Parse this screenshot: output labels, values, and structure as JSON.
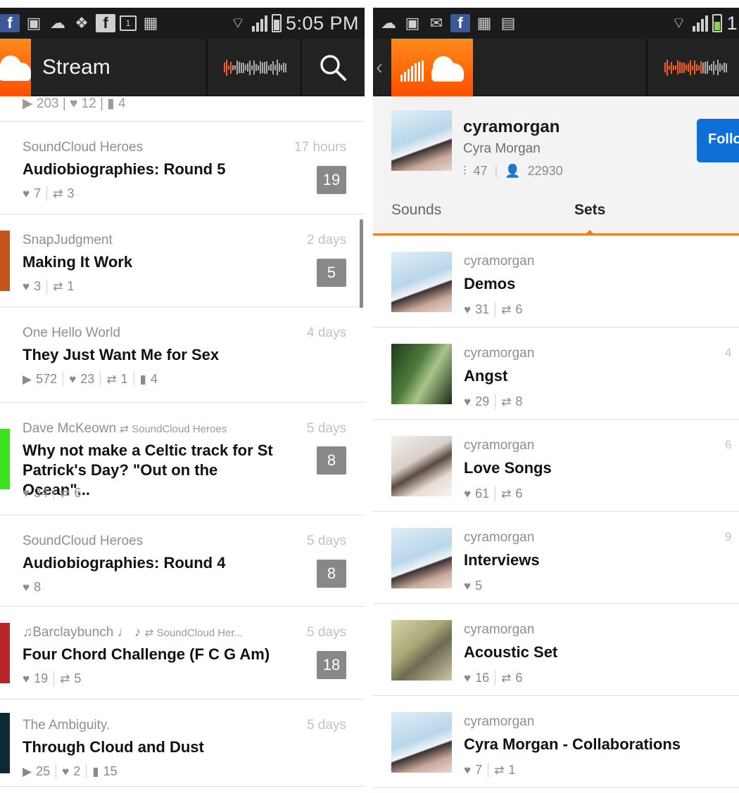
{
  "left": {
    "status": {
      "time": "5:05 PM"
    },
    "actionbar": {
      "title": "Stream"
    },
    "partial_row": {
      "plays": "203",
      "likes": "12",
      "comments": "4"
    },
    "stream": [
      {
        "user": "SoundCloud Heroes",
        "reposted_by": "",
        "time": "17 hours",
        "title": "Audiobiographies: Round 5",
        "plays": "",
        "likes": "7",
        "reposts": "3",
        "comments": "",
        "count": "19",
        "thumb_color": "#ffffff"
      },
      {
        "user": "SnapJudgment",
        "reposted_by": "",
        "time": "2 days",
        "title": "Making It Work",
        "plays": "",
        "likes": "3",
        "reposts": "1",
        "comments": "",
        "count": "5",
        "thumb_color": "#c4541c"
      },
      {
        "user": "One Hello World",
        "reposted_by": "",
        "time": "4 days",
        "title": "They Just Want Me for Sex",
        "plays": "572",
        "likes": "23",
        "reposts": "1",
        "comments": "4",
        "count": "",
        "thumb_color": "#ffffff"
      },
      {
        "user": "Dave McKeown",
        "reposted_by": "SoundCloud Heroes",
        "time": "5 days",
        "title": "Why not make a Celtic track for St Patrick's Day? \"Out on the Ocean\"...",
        "plays": "",
        "likes": "34",
        "reposts": "6",
        "comments": "",
        "count": "8",
        "thumb_color": "#3be01f"
      },
      {
        "user": "SoundCloud Heroes",
        "reposted_by": "",
        "time": "5 days",
        "title": "Audiobiographies: Round 4",
        "plays": "",
        "likes": "8",
        "reposts": "",
        "comments": "",
        "count": "8",
        "thumb_color": "#ffffff"
      },
      {
        "user": "♫Barclaybunch ♩ ♪",
        "reposted_by": "SoundCloud Her...",
        "time": "5 days",
        "title": "Four Chord Challenge (F C G Am)",
        "plays": "",
        "likes": "19",
        "reposts": "5",
        "comments": "",
        "count": "18",
        "thumb_color": "#b8262b"
      },
      {
        "user": "The Ambiguity.",
        "reposted_by": "",
        "time": "5 days",
        "title": "Through Cloud and Dust",
        "plays": "25",
        "likes": "2",
        "reposts": "",
        "comments": "15",
        "count": "",
        "thumb_color": "#0d2a33"
      }
    ]
  },
  "right": {
    "status": {
      "time": "1:"
    },
    "profile": {
      "username": "cyramorgan",
      "name": "Cyra Morgan",
      "tracks": "47",
      "followers": "22930",
      "follow_label": "Follo"
    },
    "tabs": [
      {
        "label": "Sounds",
        "active": false
      },
      {
        "label": "Sets",
        "active": true
      }
    ],
    "sets": [
      {
        "user": "cyramorgan",
        "title": "Demos",
        "likes": "31",
        "reposts": "6",
        "num": "",
        "img": "sky"
      },
      {
        "user": "cyramorgan",
        "title": "Angst",
        "likes": "29",
        "reposts": "8",
        "num": "4",
        "img": "green"
      },
      {
        "user": "cyramorgan",
        "title": "Love Songs",
        "likes": "61",
        "reposts": "6",
        "num": "6",
        "img": "light"
      },
      {
        "user": "cyramorgan",
        "title": "Interviews",
        "likes": "5",
        "reposts": "",
        "num": "9",
        "img": "sky"
      },
      {
        "user": "cyramorgan",
        "title": "Acoustic Set",
        "likes": "16",
        "reposts": "6",
        "num": "",
        "img": "warm"
      },
      {
        "user": "cyramorgan",
        "title": "Cyra Morgan - Collaborations",
        "likes": "7",
        "reposts": "1",
        "num": "",
        "img": "sky"
      }
    ]
  },
  "colors": {
    "accent": "#f37a1f",
    "follow": "#0e6fd6",
    "badge": "#888888",
    "statusbar": "#1b1b1b",
    "actionbar": "#222222"
  }
}
